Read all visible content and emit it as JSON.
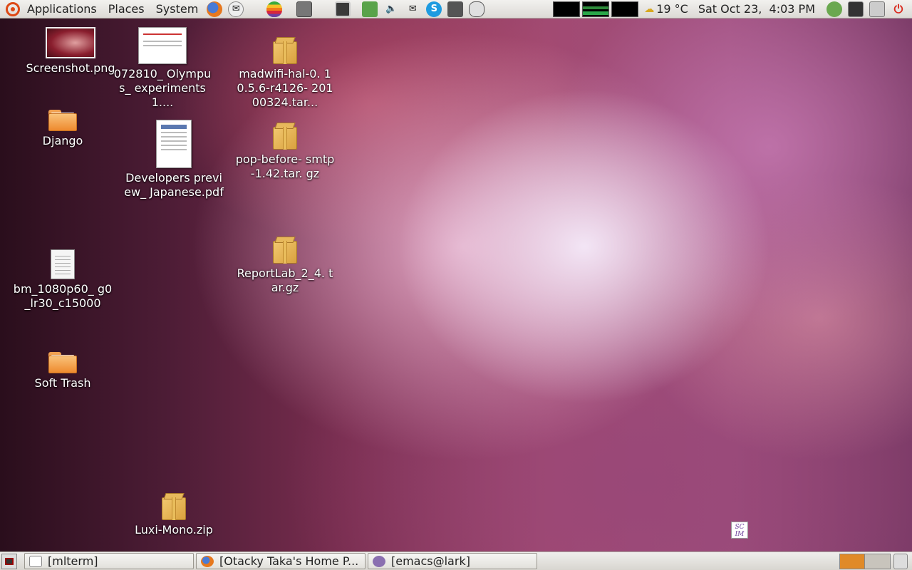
{
  "top_panel": {
    "menus": [
      "Applications",
      "Places",
      "System"
    ],
    "weather": "19 °C",
    "clock": "Sat Oct 23,  4:03 PM"
  },
  "desktop": {
    "icons": [
      {
        "label": "Screenshot.png",
        "type": "image"
      },
      {
        "label": "072810_ Olympus_ experiments1....",
        "type": "document"
      },
      {
        "label": "madwifi-hal-0. 10.5.6-r4126- 20100324.tar...",
        "type": "package"
      },
      {
        "label": "Django",
        "type": "folder"
      },
      {
        "label": "Developers preview_ Japanese.pdf",
        "type": "pdf"
      },
      {
        "label": "pop-before- smtp-1.42.tar. gz",
        "type": "package"
      },
      {
        "label": "bm_1080p60_ g0_lr30_c15000",
        "type": "text"
      },
      {
        "label": "ReportLab_2_4. tar.gz",
        "type": "package"
      },
      {
        "label": "Soft Trash",
        "type": "folder"
      },
      {
        "label": "Luxi-Mono.zip",
        "type": "package"
      }
    ],
    "scim_label": "SCIM"
  },
  "bottom_panel": {
    "tasks": [
      {
        "label": "[mlterm]"
      },
      {
        "label": "[Otacky Taka's Home P..."
      },
      {
        "label": "[emacs@lark]"
      }
    ],
    "workspace_colors": [
      "#e08a28",
      "#c8c4bc"
    ]
  },
  "colors": {
    "accent": "#dd4814",
    "folder": "#ee8a2e",
    "package": "#d9a13e"
  }
}
